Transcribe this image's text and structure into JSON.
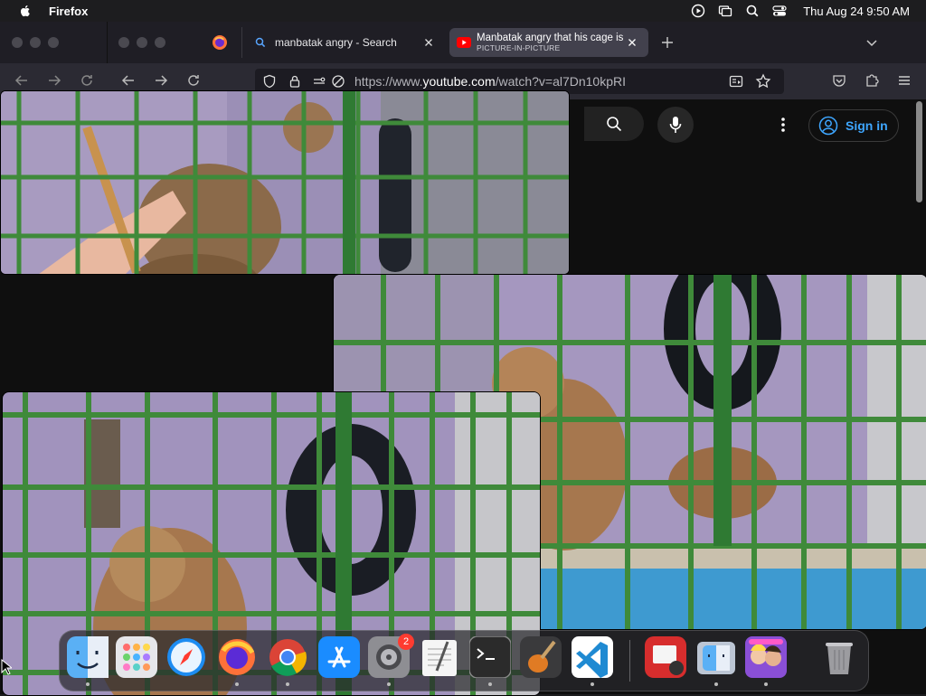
{
  "menubar": {
    "app_name": "Firefox",
    "datetime": "Thu Aug 24  9:50 AM"
  },
  "browser": {
    "tabs": [
      {
        "title": "manbatak angry - Search",
        "icon": "search-icon"
      },
      {
        "title": "Manbatak angry that his cage is",
        "subtitle": "PICTURE-IN-PICTURE",
        "icon": "youtube-icon"
      }
    ],
    "url_prefix": "https://www.",
    "url_host": "youtube.com",
    "url_path": "/watch?v=al7Dn10kpRI"
  },
  "youtube": {
    "signin_label": "Sign in"
  },
  "dock": {
    "apps": [
      "Finder",
      "Launchpad",
      "Safari",
      "Firefox",
      "Chrome",
      "App Store",
      "System Settings",
      "TextEdit",
      "Terminal",
      "GarageBand",
      "Visual Studio Code",
      "Photo Booth",
      "Finder Copy",
      "Game",
      "Trash"
    ],
    "settings_badge": "2"
  },
  "colors": {
    "accent_link": "#3ea6ff",
    "badge": "#ff3b30",
    "cage_green": "#3f8a3a",
    "wall_purple": "#9c8fb6"
  }
}
